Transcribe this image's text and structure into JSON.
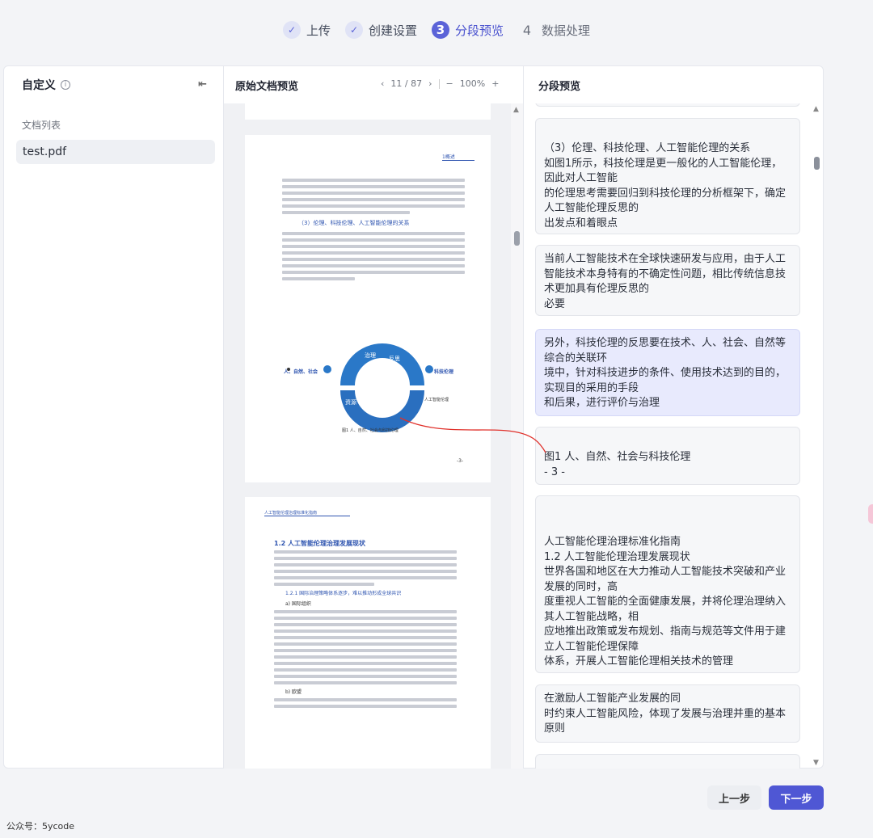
{
  "stepper": [
    {
      "icon": "✓",
      "label": "上传",
      "state": "done"
    },
    {
      "icon": "✓",
      "label": "创建设置",
      "state": "done"
    },
    {
      "icon": "3",
      "label": "分段预览",
      "state": "active"
    },
    {
      "icon": "4",
      "label": "数据处理",
      "state": "todo"
    }
  ],
  "left": {
    "title": "自定义",
    "info_icon": "i",
    "collapse_icon": "⇤",
    "list_title": "文档列表",
    "files": [
      "test.pdf"
    ]
  },
  "mid": {
    "title": "原始文档预览",
    "page_indicator": "11 / 87",
    "prev": "‹",
    "next": "›",
    "zoom_out": "−",
    "zoom": "100%",
    "zoom_in": "+",
    "page1": {
      "header_tag": "1概述",
      "section_heading": "（3）伦理、科技伦理、人工智能伦理的关系",
      "figure_labels": [
        "评估",
        "治理",
        "反思",
        "资源",
        "协同",
        "发展"
      ],
      "left_cluster": "人、自然、社会",
      "right_cluster": "科技伦理",
      "right_bottom": "人工智能伦理",
      "caption": "图1 人、自然、社会与科技伦理",
      "page_no": "-3-"
    },
    "page2": {
      "header_tag": "人工智能伦理治理标准化指南",
      "heading": "1.2 人工智能伦理治理发展现状",
      "sub_heading": "1.2.1 国际治理策略体系逐步，难以推动形成全球共识",
      "item_a": "a) 国际组织",
      "item_b": "b) 欧盟"
    }
  },
  "right": {
    "title": "分段预览",
    "chunks": [
      {
        "text": "（3）伦理、科技伦理、人工智能伦理的关系\n如图1所示，科技伦理是更一般化的人工智能伦理，因此对人工智能\n的伦理思考需要回归到科技伦理的分析框架下，确定人工智能伦理反思的\n出发点和着眼点",
        "highlight": false
      },
      {
        "text": "当前人工智能技术在全球快速研发与应用，由于人工智能技术本身特有的不确定性问题，相比传统信息技术更加具有伦理反思的\n必要",
        "highlight": false
      },
      {
        "text": "另外，科技伦理的反思要在技术、人、社会、自然等综合的关联环\n境中，针对科技进步的条件、使用技术达到的目的，实现目的采用的手段\n和后果，进行评价与治理",
        "highlight": true
      },
      {
        "text": "图1 人、自然、社会与科技伦理\n- 3 -",
        "highlight": false
      },
      {
        "text": "人工智能伦理治理标准化指南\n1.2 人工智能伦理治理发展现状\n世界各国和地区在大力推动人工智能技术突破和产业发展的同时，高\n度重视人工智能的全面健康发展，并将伦理治理纳入其人工智能战略，相\n应地推出政策或发布规划、指南与规范等文件用于建立人工智能伦理保障\n体系，开展人工智能伦理相关技术的管理",
        "highlight": false
      },
      {
        "text": "在激励人工智能产业发展的同\n时约束人工智能风险，体现了发展与治理并重的基本原则",
        "highlight": false
      }
    ]
  },
  "buttons": {
    "prev": "上一步",
    "next": "下一步"
  },
  "footer": "公众号：5ycode",
  "colors": {
    "accent": "#4f57d4",
    "highlight": "#e8eafd",
    "annotation": "#e0302a"
  }
}
